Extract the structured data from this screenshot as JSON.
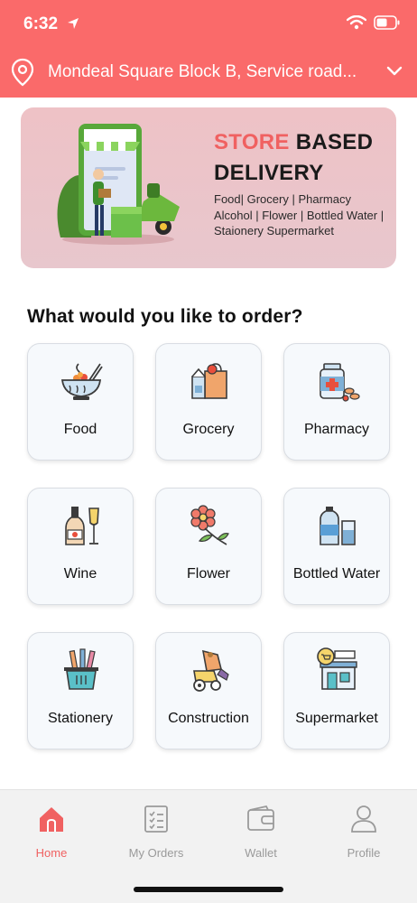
{
  "status": {
    "time": "6:32"
  },
  "header": {
    "address": "Mondeal Square Block B, Service road..."
  },
  "banner": {
    "title_accent": "STORE",
    "title_rest": "BASED",
    "title_line2": "DELIVERY",
    "subtitle": "Food| Grocery | Pharmacy Alcohol | Flower | Bottled Water | Staionery Supermarket"
  },
  "section": {
    "title": "What would you like to order?"
  },
  "categories": [
    {
      "label": "Food",
      "icon": "food-bowl-icon"
    },
    {
      "label": "Grocery",
      "icon": "grocery-bag-icon"
    },
    {
      "label": "Pharmacy",
      "icon": "pharmacy-bottle-icon"
    },
    {
      "label": "Wine",
      "icon": "wine-bottle-icon"
    },
    {
      "label": "Flower",
      "icon": "flower-icon"
    },
    {
      "label": "Bottled Water",
      "icon": "water-bottle-icon"
    },
    {
      "label": "Stationery",
      "icon": "pencil-cup-icon"
    },
    {
      "label": "Construction",
      "icon": "cement-mixer-icon"
    },
    {
      "label": "Supermarket",
      "icon": "store-front-icon"
    }
  ],
  "nav": {
    "items": [
      {
        "label": "Home",
        "icon": "home-icon",
        "active": true
      },
      {
        "label": "My Orders",
        "icon": "checklist-icon",
        "active": false
      },
      {
        "label": "Wallet",
        "icon": "wallet-icon",
        "active": false
      },
      {
        "label": "Profile",
        "icon": "person-icon",
        "active": false
      }
    ]
  },
  "colors": {
    "accent": "#fa6a6a",
    "accent_text": "#f06161",
    "tile_bg": "#f6f9fc"
  }
}
